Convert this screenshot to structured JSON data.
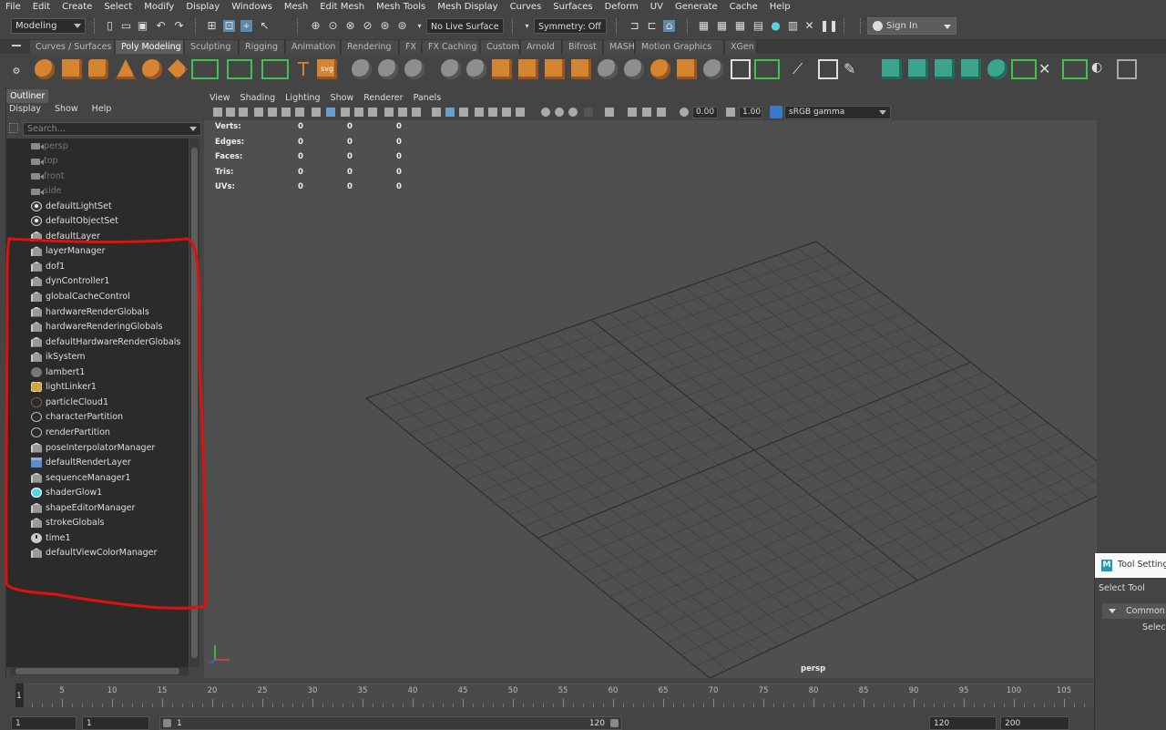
{
  "menubar": [
    "File",
    "Edit",
    "Create",
    "Select",
    "Modify",
    "Display",
    "Windows",
    "Mesh",
    "Edit Mesh",
    "Mesh Tools",
    "Mesh Display",
    "Curves",
    "Surfaces",
    "Deform",
    "UV",
    "Generate",
    "Cache",
    "Help"
  ],
  "status": {
    "mode": "Modeling",
    "live_surface": "No Live Surface",
    "symmetry": "Symmetry: Off",
    "sign_in": "Sign In"
  },
  "shelf_tabs": [
    "Curves / Surfaces",
    "Poly Modeling",
    "Sculpting",
    "Rigging",
    "Animation",
    "Rendering",
    "FX",
    "FX Caching",
    "Custom",
    "Arnold",
    "Bifrost",
    "MASH",
    "Motion Graphics",
    "XGen"
  ],
  "shelf_active_tab": "Poly Modeling",
  "outliner": {
    "tab": "Outliner",
    "menu": [
      "Display",
      "Show",
      "Help"
    ],
    "search_placeholder": "Search...",
    "items": [
      {
        "label": "persp",
        "icon": "camera-icon",
        "dim": true
      },
      {
        "label": "top",
        "icon": "camera-icon",
        "dim": true
      },
      {
        "label": "front",
        "icon": "camera-icon",
        "dim": true
      },
      {
        "label": "side",
        "icon": "camera-icon",
        "dim": true
      },
      {
        "label": "defaultLightSet",
        "icon": "set-icon",
        "dim": false
      },
      {
        "label": "defaultObjectSet",
        "icon": "set-icon",
        "dim": false
      },
      {
        "label": "defaultLayer",
        "icon": "node-icon",
        "dim": false
      },
      {
        "label": "layerManager",
        "icon": "node-icon",
        "dim": false
      },
      {
        "label": "dof1",
        "icon": "node-icon",
        "dim": false
      },
      {
        "label": "dynController1",
        "icon": "node-icon",
        "dim": false
      },
      {
        "label": "globalCacheControl",
        "icon": "node-icon",
        "dim": false
      },
      {
        "label": "hardwareRenderGlobals",
        "icon": "node-icon",
        "dim": false
      },
      {
        "label": "hardwareRenderingGlobals",
        "icon": "node-icon",
        "dim": false
      },
      {
        "label": "defaultHardwareRenderGlobals",
        "icon": "node-icon",
        "dim": false
      },
      {
        "label": "ikSystem",
        "icon": "node-icon",
        "dim": false
      },
      {
        "label": "lambert1",
        "icon": "material-sphere-icon",
        "dim": false
      },
      {
        "label": "lightLinker1",
        "icon": "light-linker-icon",
        "dim": false
      },
      {
        "label": "particleCloud1",
        "icon": "particle-icon",
        "dim": false
      },
      {
        "label": "characterPartition",
        "icon": "partition-icon",
        "dim": false
      },
      {
        "label": "renderPartition",
        "icon": "partition-icon",
        "dim": false
      },
      {
        "label": "poseInterpolatorManager",
        "icon": "node-icon",
        "dim": false
      },
      {
        "label": "defaultRenderLayer",
        "icon": "render-layer-icon",
        "dim": false
      },
      {
        "label": "sequenceManager1",
        "icon": "node-icon",
        "dim": false
      },
      {
        "label": "shaderGlow1",
        "icon": "shader-glow-icon",
        "dim": false
      },
      {
        "label": "shapeEditorManager",
        "icon": "node-icon",
        "dim": false
      },
      {
        "label": "strokeGlobals",
        "icon": "node-icon",
        "dim": false
      },
      {
        "label": "time1",
        "icon": "time-icon",
        "dim": false
      },
      {
        "label": "defaultViewColorManager",
        "icon": "node-icon",
        "dim": false
      }
    ]
  },
  "viewport": {
    "menu": [
      "View",
      "Shading",
      "Lighting",
      "Show",
      "Renderer",
      "Panels"
    ],
    "exposure": "0.00",
    "gamma_value": "1.00",
    "color_space": "sRGB gamma",
    "hud": [
      {
        "label": "Verts:",
        "values": [
          "0",
          "0",
          "0"
        ]
      },
      {
        "label": "Edges:",
        "values": [
          "0",
          "0",
          "0"
        ]
      },
      {
        "label": "Faces:",
        "values": [
          "0",
          "0",
          "0"
        ]
      },
      {
        "label": "Tris:",
        "values": [
          "0",
          "0",
          "0"
        ]
      },
      {
        "label": "UVs:",
        "values": [
          "0",
          "0",
          "0"
        ]
      }
    ],
    "camera_label": "persp"
  },
  "timeline": {
    "current_frame": "1",
    "ticks": [
      "5",
      "10",
      "15",
      "20",
      "25",
      "30",
      "35",
      "40",
      "45",
      "50",
      "55",
      "60",
      "65",
      "70",
      "75",
      "80",
      "85",
      "90",
      "95",
      "100",
      "105"
    ]
  },
  "range": {
    "start": "1",
    "playback_start": "1",
    "slider_start": "1",
    "slider_end": "120",
    "playback_end": "120",
    "end": "200"
  },
  "tool_settings": {
    "title": "Tool Settings",
    "tool": "Select Tool",
    "section": "Common Selection Options",
    "row": "Selection"
  },
  "annotation_color": "#e01010"
}
